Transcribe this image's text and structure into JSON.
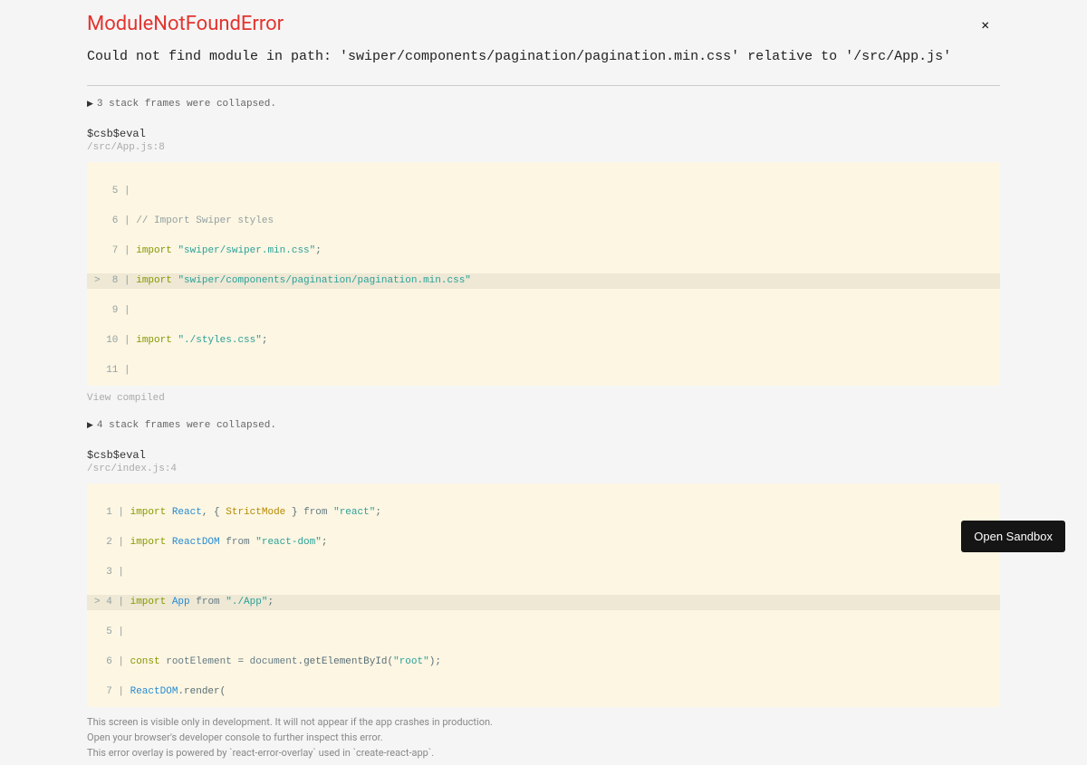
{
  "error": {
    "title": "ModuleNotFoundError",
    "message": "Could not find module in path: 'swiper/components/pagination/pagination.min.css' relative to '/src/App.js'"
  },
  "frames": [
    {
      "collapsed_text": "3 stack frames were collapsed.",
      "source": "$csb$eval",
      "location": "/src/App.js:8",
      "view_compiled": "View compiled"
    },
    {
      "collapsed_text": "4 stack frames were collapsed.",
      "source": "$csb$eval",
      "location": "/src/index.js:4"
    }
  ],
  "footer": {
    "line1": "This screen is visible only in development. It will not appear if the app crashes in production.",
    "line2": "Open your browser's developer console to further inspect this error.",
    "line3": "This error overlay is powered by `react-error-overlay` used in `create-react-app`."
  },
  "buttons": {
    "close": "×",
    "open_sandbox": "Open Sandbox"
  },
  "code1": {
    "l5": "   5 | ",
    "l6_gutter": "   6 | ",
    "l6_comment": "// Import Swiper styles",
    "l7_gutter": "   7 | ",
    "l7_import": "import",
    "l7_str": "\"swiper/swiper.min.css\"",
    "l7_semi": ";",
    "l8_gutter": ">  8 | ",
    "l8_import": "import",
    "l8_str": "\"swiper/components/pagination/pagination.min.css\"",
    "l9": "   9 | ",
    "l10_gutter": "  10 | ",
    "l10_import": "import",
    "l10_str": "\"./styles.css\"",
    "l10_semi": ";",
    "l11": "  11 | "
  },
  "code2": {
    "l1_gutter": "  1 | ",
    "l1_import": "import",
    "l1_react": "React",
    "l1_comma": ",",
    "l1_brace1": " { ",
    "l1_strict": "StrictMode",
    "l1_brace2": " } ",
    "l1_from": "from ",
    "l1_str": "\"react\"",
    "l1_semi": ";",
    "l2_gutter": "  2 | ",
    "l2_import": "import",
    "l2_reactdom": "ReactDOM",
    "l2_from": " from ",
    "l2_str": "\"react-dom\"",
    "l2_semi": ";",
    "l3": "  3 | ",
    "l4_gutter": "> 4 | ",
    "l4_import": "import",
    "l4_app": "App",
    "l4_from": " from ",
    "l4_str": "\"./App\"",
    "l4_semi": ";",
    "l5": "  5 | ",
    "l6_gutter": "  6 | ",
    "l6_const": "const",
    "l6_root": " rootElement ",
    "l6_eq": "=",
    "l6_doc": " document",
    "l6_get": ".getElementById(",
    "l6_str": "\"root\"",
    "l6_close": ");",
    "l7_gutter": "  7 | ",
    "l7_reactdom": "ReactDOM",
    "l7_render": ".render("
  }
}
